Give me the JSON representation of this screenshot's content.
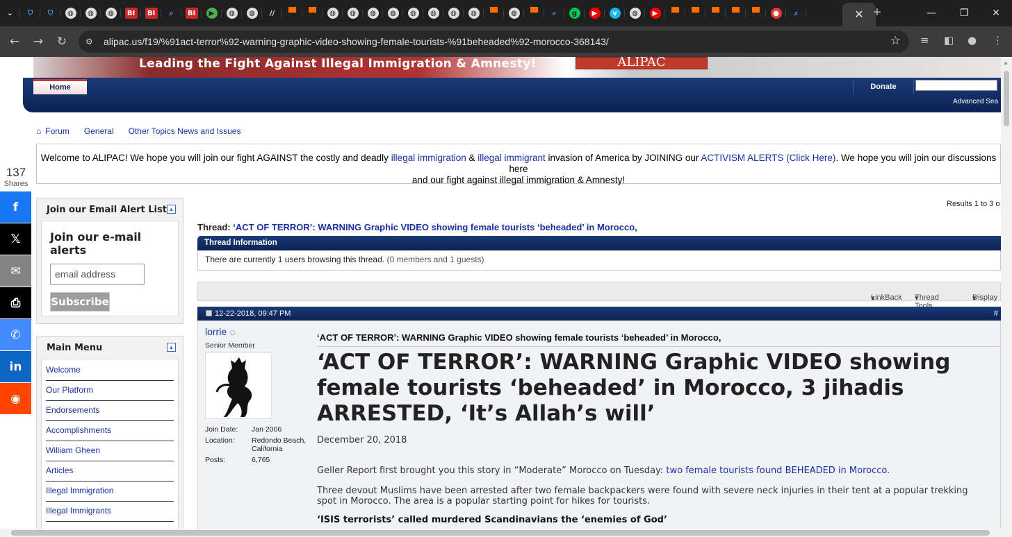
{
  "browser": {
    "tabs": [
      {
        "icon": "chevron-down-icon",
        "glyph": "⌄",
        "color": "#ffffff",
        "bg": "transparent"
      },
      {
        "icon": "shield-icon",
        "glyph": "⛉",
        "color": "#4aa3ff",
        "bg": "transparent"
      },
      {
        "icon": "shield-icon",
        "glyph": "⛉",
        "color": "#4aa3ff",
        "bg": "transparent"
      },
      {
        "icon": "globe-icon",
        "glyph": "◍",
        "color": "#1f1f1f",
        "bg": "#e0e0e0"
      },
      {
        "icon": "globe-icon",
        "glyph": "◍",
        "color": "#1f1f1f",
        "bg": "#e0e0e0"
      },
      {
        "icon": "globe-icon",
        "glyph": "◍",
        "color": "#1f1f1f",
        "bg": "#e0e0e0"
      },
      {
        "icon": "bi-icon",
        "glyph": "BI",
        "color": "#ffffff",
        "bg": "#c62828"
      },
      {
        "icon": "bi-icon",
        "glyph": "BI",
        "color": "#ffffff",
        "bg": "#c62828"
      },
      {
        "icon": "search-icon",
        "glyph": "⌕",
        "color": "#4aa3ff",
        "bg": "transparent"
      },
      {
        "icon": "bi-icon",
        "glyph": "BI",
        "color": "#ffffff",
        "bg": "#c62828"
      },
      {
        "icon": "play-icon",
        "glyph": "▶",
        "color": "#1f1f1f",
        "bg": "#4caf50"
      },
      {
        "icon": "globe-icon",
        "glyph": "◍",
        "color": "#1f1f1f",
        "bg": "#e0e0e0"
      },
      {
        "icon": "globe-icon",
        "glyph": "◍",
        "color": "#1f1f1f",
        "bg": "#e0e0e0"
      },
      {
        "icon": "slash-icon",
        "glyph": "//",
        "color": "#e0e0e0",
        "bg": "transparent"
      },
      {
        "icon": "bookmark-icon",
        "glyph": "▀",
        "color": "#ff6d00",
        "bg": "transparent"
      },
      {
        "icon": "bookmark-icon",
        "glyph": "▀",
        "color": "#ff6d00",
        "bg": "transparent"
      },
      {
        "icon": "globe-icon",
        "glyph": "◍",
        "color": "#1f1f1f",
        "bg": "#e0e0e0"
      },
      {
        "icon": "globe-icon",
        "glyph": "◍",
        "color": "#1f1f1f",
        "bg": "#e0e0e0"
      },
      {
        "icon": "globe-icon",
        "glyph": "◍",
        "color": "#1f1f1f",
        "bg": "#e0e0e0"
      },
      {
        "icon": "globe-icon",
        "glyph": "◍",
        "color": "#1f1f1f",
        "bg": "#e0e0e0"
      },
      {
        "icon": "globe-icon",
        "glyph": "◍",
        "color": "#1f1f1f",
        "bg": "#e0e0e0"
      },
      {
        "icon": "globe-icon",
        "glyph": "◍",
        "color": "#1f1f1f",
        "bg": "#e0e0e0"
      },
      {
        "icon": "globe-icon",
        "glyph": "◍",
        "color": "#1f1f1f",
        "bg": "#e0e0e0"
      },
      {
        "icon": "globe-icon",
        "glyph": "◍",
        "color": "#1f1f1f",
        "bg": "#e0e0e0"
      },
      {
        "icon": "bookmark-icon",
        "glyph": "▀",
        "color": "#ff6d00",
        "bg": "transparent"
      },
      {
        "icon": "globe-icon",
        "glyph": "◍",
        "color": "#1f1f1f",
        "bg": "#e0e0e0"
      },
      {
        "icon": "bookmark-icon",
        "glyph": "▀",
        "color": "#ff6d00",
        "bg": "transparent"
      },
      {
        "icon": "search-icon",
        "glyph": "⌕",
        "color": "#4aa3ff",
        "bg": "transparent"
      },
      {
        "icon": "g-icon",
        "glyph": "g",
        "color": "#1f1f1f",
        "bg": "#00c853"
      },
      {
        "icon": "youtube-icon",
        "glyph": "▶",
        "color": "#ffffff",
        "bg": "#ff0000"
      },
      {
        "icon": "vimeo-icon",
        "glyph": "v",
        "color": "#ffffff",
        "bg": "#1ab7ea"
      },
      {
        "icon": "globe-icon",
        "glyph": "◍",
        "color": "#1f1f1f",
        "bg": "#e0e0e0"
      },
      {
        "icon": "youtube-icon",
        "glyph": "▶",
        "color": "#ffffff",
        "bg": "#ff0000"
      },
      {
        "icon": "bookmark-icon",
        "glyph": "▀",
        "color": "#ff6d00",
        "bg": "transparent"
      },
      {
        "icon": "bookmark-icon",
        "glyph": "▀",
        "color": "#ff6d00",
        "bg": "transparent"
      },
      {
        "icon": "bookmark-icon",
        "glyph": "▀",
        "color": "#ff6d00",
        "bg": "transparent"
      },
      {
        "icon": "bookmark-icon",
        "glyph": "▀",
        "color": "#ff6d00",
        "bg": "transparent"
      },
      {
        "icon": "bookmark-icon",
        "glyph": "▀",
        "color": "#ff6d00",
        "bg": "transparent"
      },
      {
        "icon": "microphone-icon",
        "glyph": "●",
        "color": "#ffffff",
        "bg": "#e53935"
      },
      {
        "icon": "search-icon",
        "glyph": "⌕",
        "color": "#4aa3ff",
        "bg": "transparent"
      }
    ],
    "url": "alipac.us/f19/%91act-terror%92-warning-graphic-video-showing-female-tourists-%91beheaded%92-morocco-368143/"
  },
  "site": {
    "banner_tagline": "Leading the Fight Against Illegal Immigration & Amnesty!",
    "banner_logo": "ALIPAC",
    "nav_home": "Home",
    "nav_donate": "Donate",
    "advanced_search": "Advanced Sea"
  },
  "breadcrumb": [
    "Forum",
    "General",
    "Other Topics News and Issues"
  ],
  "welcome": {
    "t1": "Welcome to ALIPAC! We hope you will join our fight AGAINST the costly and deadly ",
    "l1": "illegal immigration",
    "t2": " & ",
    "l2": "illegal immigrant",
    "t3": " invasion of America by JOINING our ",
    "l3": "ACTIVISM ALERTS (Click Here)",
    "t4": ". We hope you will join our discussions here",
    "t5": "and our fight against illegal immigration & Amnesty!"
  },
  "share": {
    "count": "137",
    "label": "Shares",
    "buttons": [
      {
        "name": "facebook-icon",
        "glyph": "f",
        "bg": "#1877f2"
      },
      {
        "name": "x-icon",
        "glyph": "𝕏",
        "bg": "#000000"
      },
      {
        "name": "email-icon",
        "glyph": "✉",
        "bg": "#848484"
      },
      {
        "name": "print-icon",
        "glyph": "⎙",
        "bg": "#000000"
      },
      {
        "name": "messenger-icon",
        "glyph": "✆",
        "bg": "#448aff"
      },
      {
        "name": "linkedin-icon",
        "glyph": "in",
        "bg": "#0a66c2"
      },
      {
        "name": "reddit-icon",
        "glyph": "◉",
        "bg": "#ff4500"
      }
    ]
  },
  "email_box": {
    "heading": "Join our Email Alert List!",
    "title": "Join our e-mail alerts",
    "placeholder": "email address",
    "button": "Subscribe"
  },
  "main_menu": {
    "heading": "Main Menu",
    "items": [
      "Welcome",
      "Our Platform",
      "Endorsements",
      "Accomplishments",
      "William Gheen",
      "Articles",
      "Illegal Immigration",
      "Illegal Immigrants"
    ]
  },
  "thread": {
    "results": "Results 1 to 3 o",
    "label": "Thread: ",
    "title": "‘ACT OF TERROR’: WARNING Graphic VIDEO showing female tourists ‘beheaded’ in Morocco,",
    "info_head": "Thread Information",
    "info_text": "There are currently 1 users browsing this thread.",
    "info_muted": " (0 members and 1 guests)",
    "tools": [
      "LinkBack",
      "Thread Tools",
      "Display"
    ]
  },
  "post": {
    "date": "12-22-2018, 09:47 PM",
    "number": "#",
    "user": "lorrie",
    "user_title": "Senior Member",
    "join_label": "Join Date:",
    "join": "Jan 2006",
    "location_label": "Location:",
    "location": "Redondo Beach, California",
    "posts_label": "Posts:",
    "posts": "6,765",
    "subject": "‘ACT OF TERROR’: WARNING Graphic VIDEO showing female tourists ‘beheaded’ in Morocco,",
    "headline": "‘ACT OF TERROR’: WARNING Graphic VIDEO showing female tourists ‘beheaded’ in Morocco, 3 jihadis ARRESTED, ‘It’s Allah’s will’",
    "article_date": "December 20, 2018",
    "p1_text": "Geller Report first brought you this story in “Moderate” Morocco on Tuesday: ",
    "p1_link": "two female tourists found BEHEADED in Morocco.",
    "p2": "Three devout Muslims have been arrested after two female backpackers were found with severe neck injuries in their tent at a popular trekking spot in Morocco. The area is a popular starting point for hikes for tourists.",
    "bold": "‘ISIS terrorists’ called murdered Scandinavians the ‘enemies of God’"
  }
}
